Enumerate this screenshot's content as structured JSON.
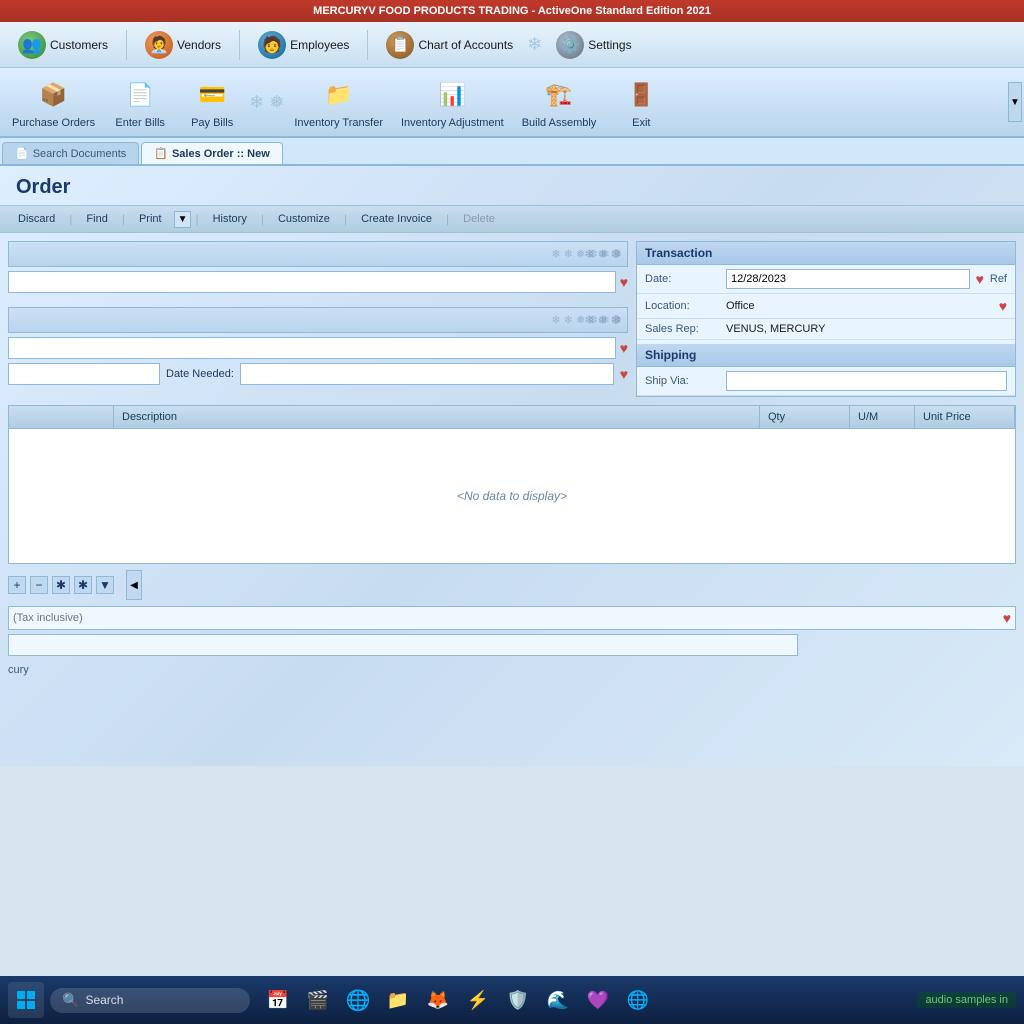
{
  "app": {
    "title": "MERCURYV FOOD PRODUCTS TRADING - ActiveOne Standard Edition 2021"
  },
  "menu": {
    "items": [
      {
        "id": "customers",
        "label": "Customers",
        "icon": "👥",
        "iconClass": "green"
      },
      {
        "id": "vendors",
        "label": "Vendors",
        "icon": "🧑‍💼",
        "iconClass": "orange"
      },
      {
        "id": "employees",
        "label": "Employees",
        "icon": "🧑‍💼",
        "iconClass": "teal"
      },
      {
        "id": "chart-accounts",
        "label": "Chart of Accounts",
        "icon": "📋",
        "iconClass": "brown"
      },
      {
        "id": "settings",
        "label": "Settings",
        "icon": "⚙️",
        "iconClass": "gear"
      }
    ]
  },
  "toolbar": {
    "items": [
      {
        "id": "purchase-orders",
        "label": "Purchase Orders",
        "icon": "📦"
      },
      {
        "id": "enter-bills",
        "label": "Enter Bills",
        "icon": "📄"
      },
      {
        "id": "pay-bills",
        "label": "Pay Bills",
        "icon": "💳"
      },
      {
        "id": "inventory-transfer",
        "label": "Inventory Transfer",
        "icon": "📁"
      },
      {
        "id": "inventory-adjustment",
        "label": "Inventory Adjustment",
        "icon": "📊"
      },
      {
        "id": "build-assembly",
        "label": "Build Assembly",
        "icon": "🏗️"
      },
      {
        "id": "exit",
        "label": "Exit",
        "icon": "🚪"
      }
    ]
  },
  "tabs": [
    {
      "id": "search-documents",
      "label": "Search Documents",
      "icon": "📄",
      "active": false
    },
    {
      "id": "sales-order-new",
      "label": "Sales Order :: New",
      "icon": "📋",
      "active": true
    }
  ],
  "page": {
    "title": "Order",
    "action_buttons": [
      {
        "id": "discard",
        "label": "Discard",
        "disabled": false
      },
      {
        "id": "find",
        "label": "Find",
        "disabled": false
      },
      {
        "id": "print",
        "label": "Print",
        "disabled": false
      },
      {
        "id": "history",
        "label": "History",
        "disabled": false
      },
      {
        "id": "customize",
        "label": "Customize",
        "disabled": false
      },
      {
        "id": "create-invoice",
        "label": "Create Invoice",
        "disabled": false
      },
      {
        "id": "delete",
        "label": "Delete",
        "disabled": true
      }
    ]
  },
  "form": {
    "date_needed_label": "Date Needed:",
    "fields": {
      "customer": "",
      "ship_to": "",
      "date_needed": ""
    }
  },
  "transaction": {
    "header": "Transaction",
    "date_label": "Date:",
    "date_value": "12/28/2023",
    "ref_label": "Ref",
    "location_label": "Location:",
    "location_value": "Office",
    "sales_rep_label": "Sales Rep:",
    "sales_rep_value": "VENUS, MERCURY"
  },
  "shipping": {
    "header": "Shipping",
    "ship_via_label": "Ship Via:",
    "ship_via_value": ""
  },
  "table": {
    "columns": [
      {
        "id": "item",
        "label": ""
      },
      {
        "id": "description",
        "label": "Description"
      },
      {
        "id": "qty",
        "label": "Qty"
      },
      {
        "id": "um",
        "label": "U/M"
      },
      {
        "id": "unit-price",
        "label": "Unit Price"
      }
    ],
    "no_data_text": "<No data to display>",
    "rows": []
  },
  "bottom_controls": {
    "buttons": [
      "+",
      "−",
      "✱",
      "✱",
      "▼"
    ]
  },
  "tax_row": {
    "placeholder": "(Tax inclusive)"
  },
  "footer": {
    "name": "cury"
  },
  "taskbar": {
    "search_placeholder": "Search",
    "audio_label": "audio samples in",
    "icons": [
      "📅",
      "🎬",
      "🌐",
      "📁",
      "🦊",
      "⚡",
      "🛡️",
      "🌊",
      "💜",
      "🌐"
    ]
  }
}
